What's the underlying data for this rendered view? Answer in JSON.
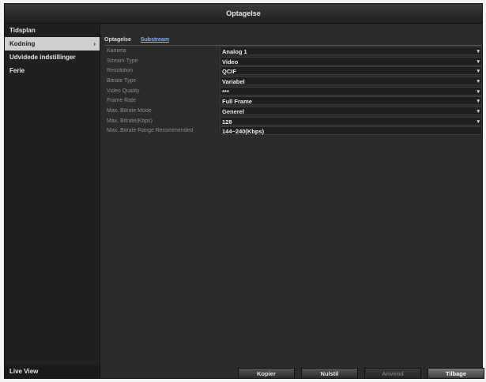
{
  "window": {
    "title": "Optagelse"
  },
  "sidebar": {
    "items": [
      {
        "label": "Tidsplan"
      },
      {
        "label": "Kodning"
      },
      {
        "label": "Udvidede indstillinger"
      },
      {
        "label": "Ferie"
      }
    ],
    "active_index": 1,
    "chevron": "›",
    "bottom": {
      "label": "Live View"
    }
  },
  "tabs": [
    {
      "label": "Optagelse"
    },
    {
      "label": "Substream"
    }
  ],
  "selected_tab": 1,
  "form": {
    "rows": [
      {
        "label": "Kamera",
        "value": "Analog 1",
        "dropdown": true
      },
      {
        "label": "Stream Type",
        "value": "Video",
        "dropdown": true
      },
      {
        "label": "Resolution",
        "value": "QCIF",
        "dropdown": true
      },
      {
        "label": "Bitrate Type",
        "value": "Variabel",
        "dropdown": true
      },
      {
        "label": "Video Quality",
        "value": "***",
        "dropdown": true
      },
      {
        "label": "Frame Rate",
        "value": "Full Frame",
        "dropdown": true
      },
      {
        "label": "Max. Bitrate Mode",
        "value": "Generel",
        "dropdown": true
      },
      {
        "label": "Max. Bitrate(Kbps)",
        "value": "128",
        "dropdown": true
      },
      {
        "label": "Max. Bitrate Range Recommended",
        "value": "144~240(Kbps)",
        "dropdown": false
      }
    ],
    "dropdown_glyph": "▾"
  },
  "buttons": {
    "copy": "Kopier",
    "apply": "Nulstil",
    "disabled": "Anvend",
    "back": "Tilbage"
  },
  "colors": {
    "background": "#2c2c2c",
    "sidebar_active": "#cfcfcf",
    "tab_selected": "#7fb2ff"
  }
}
